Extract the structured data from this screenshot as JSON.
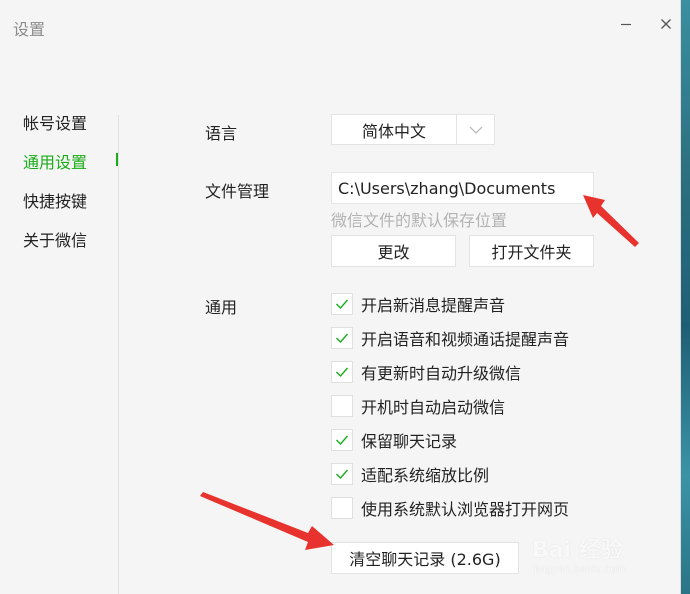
{
  "window": {
    "title": "设置"
  },
  "sidebar": {
    "items": [
      {
        "label": "帐号设置",
        "active": false
      },
      {
        "label": "通用设置",
        "active": true
      },
      {
        "label": "快捷按键",
        "active": false
      },
      {
        "label": "关于微信",
        "active": false
      }
    ]
  },
  "language": {
    "label": "语言",
    "value": "简体中文"
  },
  "file_management": {
    "label": "文件管理",
    "path": "C:\\Users\\zhang\\Documents",
    "hint": "微信文件的默认保存位置",
    "change_button": "更改",
    "open_folder_button": "打开文件夹"
  },
  "general": {
    "label": "通用",
    "options": [
      {
        "label": "开启新消息提醒声音",
        "checked": true
      },
      {
        "label": "开启语音和视频通话提醒声音",
        "checked": true
      },
      {
        "label": "有更新时自动升级微信",
        "checked": true
      },
      {
        "label": "开机时自动启动微信",
        "checked": false
      },
      {
        "label": "保留聊天记录",
        "checked": true
      },
      {
        "label": "适配系统缩放比例",
        "checked": true
      },
      {
        "label": "使用系统默认浏览器打开网页",
        "checked": false
      }
    ]
  },
  "clear_history_button": "清空聊天记录 (2.6G)",
  "watermark": {
    "main": "Bai 经验",
    "sub": "jingyan.baidu.com"
  },
  "colors": {
    "accent": "#1aad19",
    "annotation_arrow": "#e8322d"
  }
}
